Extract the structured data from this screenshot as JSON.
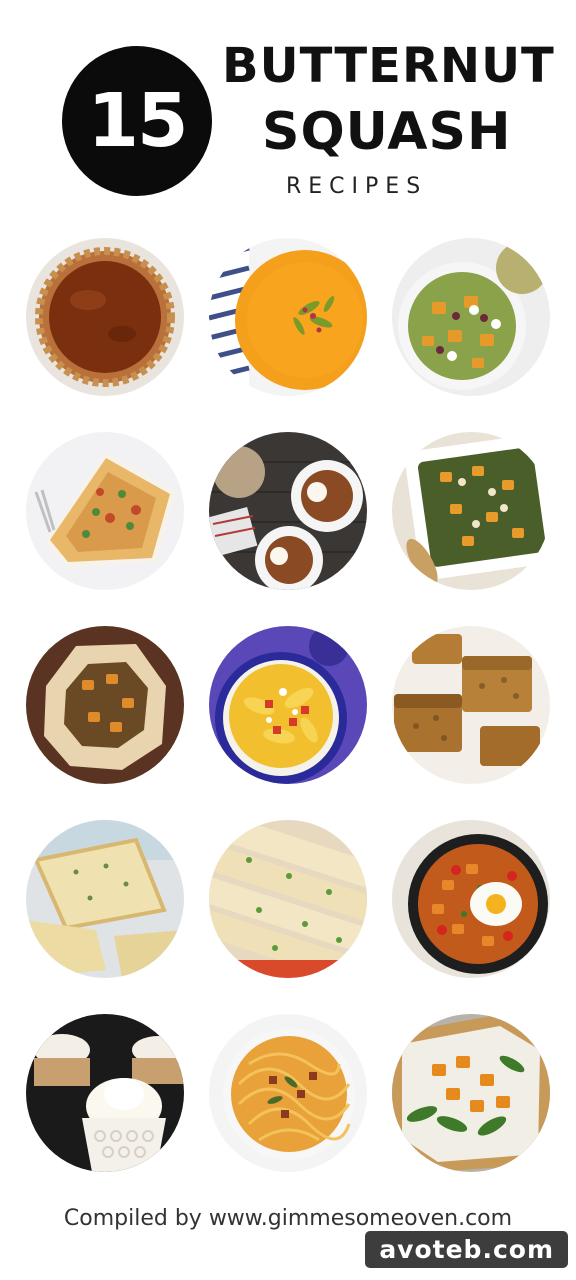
{
  "header": {
    "badge_number": "15",
    "title_line_1": "BUTTERNUT",
    "title_line_2": "SQUASH",
    "title_line_3": "RECIPES"
  },
  "footer": {
    "credit": "Compiled by www.gimmesomeoven.com",
    "watermark": "avoteb.com"
  }
}
